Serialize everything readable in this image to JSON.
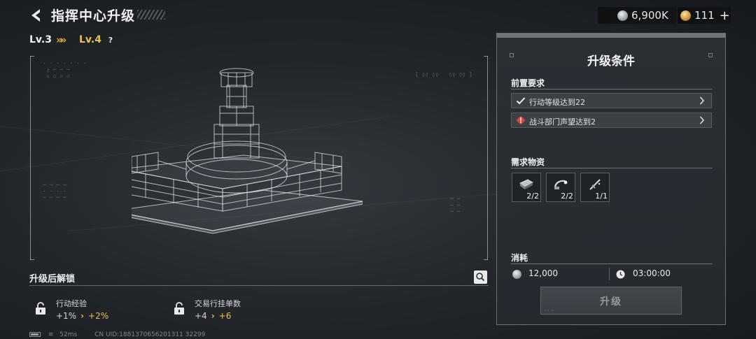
{
  "header": {
    "title": "指挥中心升级",
    "currencies": [
      {
        "icon": "silver-coin-icon",
        "amount": "6,900K"
      },
      {
        "icon": "gold-coin-icon",
        "amount": "111"
      }
    ],
    "plus_label": "+"
  },
  "level": {
    "current": "Lv.3",
    "next": "Lv.4",
    "arrows": "»»",
    "help": "?"
  },
  "unlock": {
    "title": "升级后解锁",
    "items": [
      {
        "label": "行动经验",
        "from": "+1%",
        "arrow": "›",
        "to": "+2%"
      },
      {
        "label": "交易行挂单数",
        "from": "+4",
        "arrow": "›",
        "to": "+6"
      }
    ]
  },
  "status": {
    "ping": "52ms",
    "uid": "CN UID:1881370656201311 32299"
  },
  "panel": {
    "title": "升级条件",
    "prereq_title": "前置要求",
    "requirements": [
      {
        "status": "met",
        "icon": "check-icon",
        "text": "行动等级达到22"
      },
      {
        "status": "unmet",
        "icon": "warning-icon",
        "text": "战斗部门声望达到2"
      }
    ],
    "materials_title": "需求物资",
    "materials": [
      {
        "icon": "armor-plate-icon",
        "count": "2/2"
      },
      {
        "icon": "cable-tool-icon",
        "count": "2/2"
      },
      {
        "icon": "blade-icon",
        "count": "1/1"
      }
    ],
    "cost_title": "消耗",
    "cost": {
      "money": "12,000",
      "time": "03:00:00"
    },
    "upgrade_button": "升级"
  },
  "colors": {
    "accent": "#e8c24a",
    "warning": "#d9463b",
    "panel": "#2c3035"
  }
}
